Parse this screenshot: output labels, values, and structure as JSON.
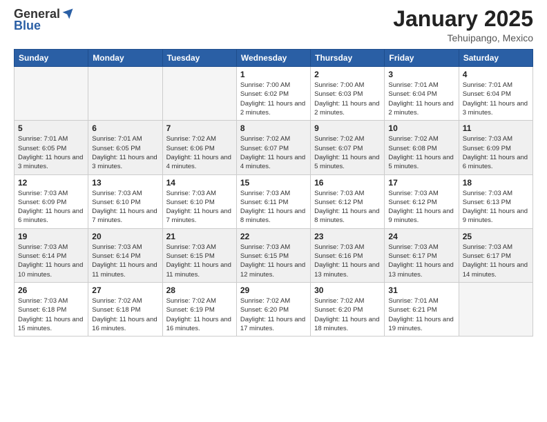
{
  "header": {
    "logo_general": "General",
    "logo_blue": "Blue",
    "title": "January 2025",
    "location": "Tehuipango, Mexico"
  },
  "weekdays": [
    "Sunday",
    "Monday",
    "Tuesday",
    "Wednesday",
    "Thursday",
    "Friday",
    "Saturday"
  ],
  "weeks": [
    [
      {
        "day": "",
        "sunrise": "",
        "sunset": "",
        "daylight": "",
        "empty": true
      },
      {
        "day": "",
        "sunrise": "",
        "sunset": "",
        "daylight": "",
        "empty": true
      },
      {
        "day": "",
        "sunrise": "",
        "sunset": "",
        "daylight": "",
        "empty": true
      },
      {
        "day": "1",
        "sunrise": "Sunrise: 7:00 AM",
        "sunset": "Sunset: 6:02 PM",
        "daylight": "Daylight: 11 hours and 2 minutes.",
        "empty": false
      },
      {
        "day": "2",
        "sunrise": "Sunrise: 7:00 AM",
        "sunset": "Sunset: 6:03 PM",
        "daylight": "Daylight: 11 hours and 2 minutes.",
        "empty": false
      },
      {
        "day": "3",
        "sunrise": "Sunrise: 7:01 AM",
        "sunset": "Sunset: 6:04 PM",
        "daylight": "Daylight: 11 hours and 2 minutes.",
        "empty": false
      },
      {
        "day": "4",
        "sunrise": "Sunrise: 7:01 AM",
        "sunset": "Sunset: 6:04 PM",
        "daylight": "Daylight: 11 hours and 3 minutes.",
        "empty": false
      }
    ],
    [
      {
        "day": "5",
        "sunrise": "Sunrise: 7:01 AM",
        "sunset": "Sunset: 6:05 PM",
        "daylight": "Daylight: 11 hours and 3 minutes.",
        "empty": false
      },
      {
        "day": "6",
        "sunrise": "Sunrise: 7:01 AM",
        "sunset": "Sunset: 6:05 PM",
        "daylight": "Daylight: 11 hours and 3 minutes.",
        "empty": false
      },
      {
        "day": "7",
        "sunrise": "Sunrise: 7:02 AM",
        "sunset": "Sunset: 6:06 PM",
        "daylight": "Daylight: 11 hours and 4 minutes.",
        "empty": false
      },
      {
        "day": "8",
        "sunrise": "Sunrise: 7:02 AM",
        "sunset": "Sunset: 6:07 PM",
        "daylight": "Daylight: 11 hours and 4 minutes.",
        "empty": false
      },
      {
        "day": "9",
        "sunrise": "Sunrise: 7:02 AM",
        "sunset": "Sunset: 6:07 PM",
        "daylight": "Daylight: 11 hours and 5 minutes.",
        "empty": false
      },
      {
        "day": "10",
        "sunrise": "Sunrise: 7:02 AM",
        "sunset": "Sunset: 6:08 PM",
        "daylight": "Daylight: 11 hours and 5 minutes.",
        "empty": false
      },
      {
        "day": "11",
        "sunrise": "Sunrise: 7:03 AM",
        "sunset": "Sunset: 6:09 PM",
        "daylight": "Daylight: 11 hours and 6 minutes.",
        "empty": false
      }
    ],
    [
      {
        "day": "12",
        "sunrise": "Sunrise: 7:03 AM",
        "sunset": "Sunset: 6:09 PM",
        "daylight": "Daylight: 11 hours and 6 minutes.",
        "empty": false
      },
      {
        "day": "13",
        "sunrise": "Sunrise: 7:03 AM",
        "sunset": "Sunset: 6:10 PM",
        "daylight": "Daylight: 11 hours and 7 minutes.",
        "empty": false
      },
      {
        "day": "14",
        "sunrise": "Sunrise: 7:03 AM",
        "sunset": "Sunset: 6:10 PM",
        "daylight": "Daylight: 11 hours and 7 minutes.",
        "empty": false
      },
      {
        "day": "15",
        "sunrise": "Sunrise: 7:03 AM",
        "sunset": "Sunset: 6:11 PM",
        "daylight": "Daylight: 11 hours and 8 minutes.",
        "empty": false
      },
      {
        "day": "16",
        "sunrise": "Sunrise: 7:03 AM",
        "sunset": "Sunset: 6:12 PM",
        "daylight": "Daylight: 11 hours and 8 minutes.",
        "empty": false
      },
      {
        "day": "17",
        "sunrise": "Sunrise: 7:03 AM",
        "sunset": "Sunset: 6:12 PM",
        "daylight": "Daylight: 11 hours and 9 minutes.",
        "empty": false
      },
      {
        "day": "18",
        "sunrise": "Sunrise: 7:03 AM",
        "sunset": "Sunset: 6:13 PM",
        "daylight": "Daylight: 11 hours and 9 minutes.",
        "empty": false
      }
    ],
    [
      {
        "day": "19",
        "sunrise": "Sunrise: 7:03 AM",
        "sunset": "Sunset: 6:14 PM",
        "daylight": "Daylight: 11 hours and 10 minutes.",
        "empty": false
      },
      {
        "day": "20",
        "sunrise": "Sunrise: 7:03 AM",
        "sunset": "Sunset: 6:14 PM",
        "daylight": "Daylight: 11 hours and 11 minutes.",
        "empty": false
      },
      {
        "day": "21",
        "sunrise": "Sunrise: 7:03 AM",
        "sunset": "Sunset: 6:15 PM",
        "daylight": "Daylight: 11 hours and 11 minutes.",
        "empty": false
      },
      {
        "day": "22",
        "sunrise": "Sunrise: 7:03 AM",
        "sunset": "Sunset: 6:15 PM",
        "daylight": "Daylight: 11 hours and 12 minutes.",
        "empty": false
      },
      {
        "day": "23",
        "sunrise": "Sunrise: 7:03 AM",
        "sunset": "Sunset: 6:16 PM",
        "daylight": "Daylight: 11 hours and 13 minutes.",
        "empty": false
      },
      {
        "day": "24",
        "sunrise": "Sunrise: 7:03 AM",
        "sunset": "Sunset: 6:17 PM",
        "daylight": "Daylight: 11 hours and 13 minutes.",
        "empty": false
      },
      {
        "day": "25",
        "sunrise": "Sunrise: 7:03 AM",
        "sunset": "Sunset: 6:17 PM",
        "daylight": "Daylight: 11 hours and 14 minutes.",
        "empty": false
      }
    ],
    [
      {
        "day": "26",
        "sunrise": "Sunrise: 7:03 AM",
        "sunset": "Sunset: 6:18 PM",
        "daylight": "Daylight: 11 hours and 15 minutes.",
        "empty": false
      },
      {
        "day": "27",
        "sunrise": "Sunrise: 7:02 AM",
        "sunset": "Sunset: 6:18 PM",
        "daylight": "Daylight: 11 hours and 16 minutes.",
        "empty": false
      },
      {
        "day": "28",
        "sunrise": "Sunrise: 7:02 AM",
        "sunset": "Sunset: 6:19 PM",
        "daylight": "Daylight: 11 hours and 16 minutes.",
        "empty": false
      },
      {
        "day": "29",
        "sunrise": "Sunrise: 7:02 AM",
        "sunset": "Sunset: 6:20 PM",
        "daylight": "Daylight: 11 hours and 17 minutes.",
        "empty": false
      },
      {
        "day": "30",
        "sunrise": "Sunrise: 7:02 AM",
        "sunset": "Sunset: 6:20 PM",
        "daylight": "Daylight: 11 hours and 18 minutes.",
        "empty": false
      },
      {
        "day": "31",
        "sunrise": "Sunrise: 7:01 AM",
        "sunset": "Sunset: 6:21 PM",
        "daylight": "Daylight: 11 hours and 19 minutes.",
        "empty": false
      },
      {
        "day": "",
        "sunrise": "",
        "sunset": "",
        "daylight": "",
        "empty": true
      }
    ]
  ]
}
